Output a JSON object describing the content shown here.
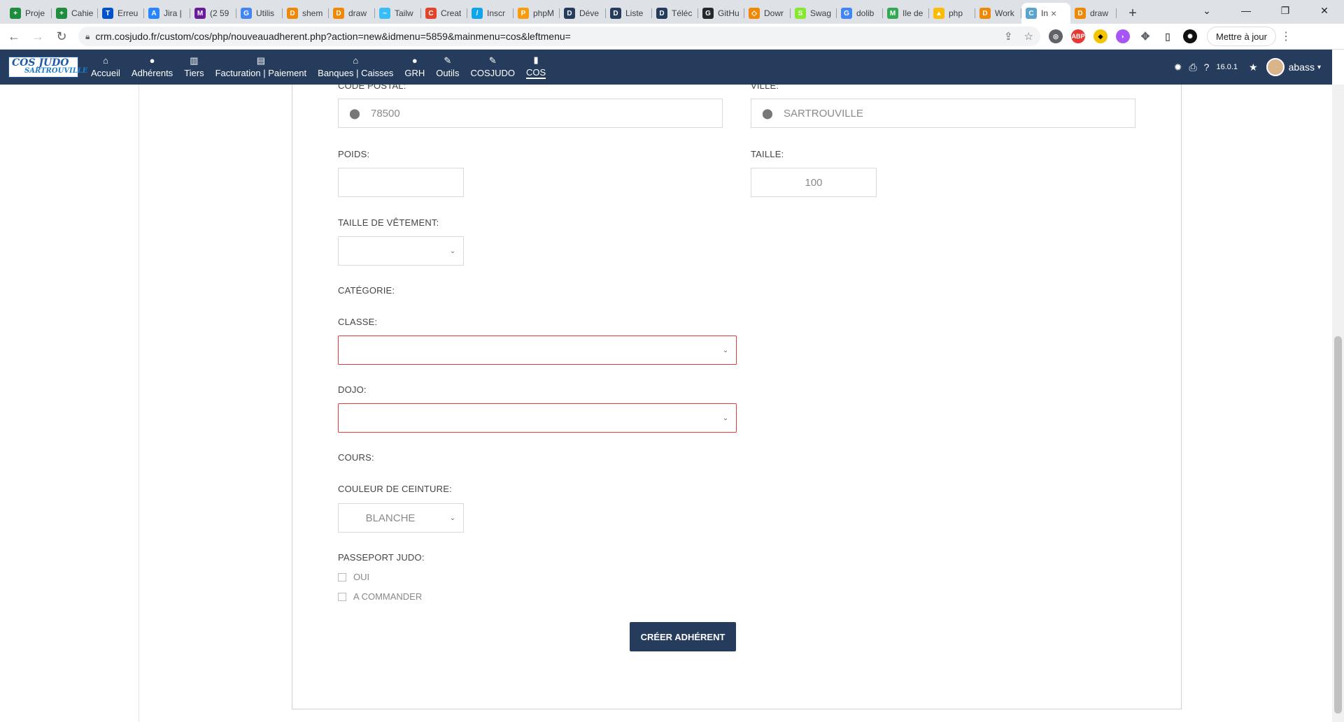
{
  "browser": {
    "tabs": [
      {
        "title": "Proje",
        "color": "#1e8e3e",
        "glyph": "+"
      },
      {
        "title": "Cahie",
        "color": "#1e8e3e",
        "glyph": "+"
      },
      {
        "title": "Erreu",
        "color": "#0052cc",
        "glyph": "T"
      },
      {
        "title": "Jira |",
        "color": "#2684ff",
        "glyph": "A"
      },
      {
        "title": "(2 59",
        "color": "#6a1b9a",
        "glyph": "M"
      },
      {
        "title": "Utilis",
        "color": "#4285f4",
        "glyph": "G"
      },
      {
        "title": "shem",
        "color": "#f08705",
        "glyph": "D"
      },
      {
        "title": "draw",
        "color": "#f08705",
        "glyph": "D"
      },
      {
        "title": "Tailw",
        "color": "#38bdf8",
        "glyph": "~"
      },
      {
        "title": "Creat",
        "color": "#e24329",
        "glyph": "C"
      },
      {
        "title": "Inscr",
        "color": "#0ea5e9",
        "glyph": "/"
      },
      {
        "title": "phpM",
        "color": "#f89c0e",
        "glyph": "P"
      },
      {
        "title": "Déve",
        "color": "#263c5c",
        "glyph": "D"
      },
      {
        "title": "Liste",
        "color": "#263c5c",
        "glyph": "D"
      },
      {
        "title": "Téléc",
        "color": "#263c5c",
        "glyph": "D"
      },
      {
        "title": "GitHu",
        "color": "#24292e",
        "glyph": "G"
      },
      {
        "title": "Dowr",
        "color": "#f08705",
        "glyph": "◇"
      },
      {
        "title": "Swag",
        "color": "#85ea2d",
        "glyph": "S"
      },
      {
        "title": "dolib",
        "color": "#4285f4",
        "glyph": "G"
      },
      {
        "title": "Ile de",
        "color": "#34a853",
        "glyph": "M"
      },
      {
        "title": "php",
        "color": "#fbbc04",
        "glyph": "▲"
      },
      {
        "title": "Work",
        "color": "#f08705",
        "glyph": "D"
      },
      {
        "title": "In",
        "color": "#5ba4cf",
        "glyph": "C",
        "active": true
      },
      {
        "title": "draw",
        "color": "#f08705",
        "glyph": "D"
      }
    ],
    "url": "crm.cosjudo.fr/custom/cos/php/nouveauadherent.php?action=new&idmenu=5859&mainmenu=cos&leftmenu=",
    "update_label": "Mettre à jour"
  },
  "app": {
    "logo": {
      "line1": "COS JUDO",
      "line2": "SARTROUVILLE"
    },
    "menu": [
      {
        "label": "Accueil",
        "icon": "⌂",
        "name": "home"
      },
      {
        "label": "Adhérents",
        "icon": "●",
        "name": "members"
      },
      {
        "label": "Tiers",
        "icon": "▥",
        "name": "thirdparties"
      },
      {
        "label": "Facturation | Paiement",
        "icon": "▤",
        "name": "billing"
      },
      {
        "label": "Banques | Caisses",
        "icon": "⌂",
        "name": "banks"
      },
      {
        "label": "GRH",
        "icon": "●",
        "name": "hr"
      },
      {
        "label": "Outils",
        "icon": "✎",
        "name": "tools"
      },
      {
        "label": "COSJUDO",
        "icon": "✎",
        "name": "cosjudo"
      },
      {
        "label": "COS",
        "icon": "▮",
        "name": "cos"
      }
    ],
    "version": "16.0.1",
    "user": "abass"
  },
  "form": {
    "code_postal": {
      "label": "CODE POSTAL:",
      "value": "78500"
    },
    "ville": {
      "label": "VILLE:",
      "value": "SARTROUVILLE"
    },
    "poids": {
      "label": "POIDS:",
      "value": ""
    },
    "taille": {
      "label": "TAILLE:",
      "value": "100"
    },
    "taille_vetement": {
      "label": "TAILLE DE VÊTEMENT:",
      "value": ""
    },
    "categorie": {
      "label": "CATÉGORIE:"
    },
    "classe": {
      "label": "CLASSE:",
      "value": ""
    },
    "dojo": {
      "label": "DOJO:",
      "value": ""
    },
    "cours": {
      "label": "COURS:"
    },
    "ceinture": {
      "label": "COULEUR DE CEINTURE:",
      "value": "BLANCHE"
    },
    "passeport": {
      "label": "PASSEPORT JUDO:",
      "options": [
        "OUI",
        "A COMMANDER"
      ]
    },
    "submit_label": "CRÉER ADHÉRENT"
  }
}
